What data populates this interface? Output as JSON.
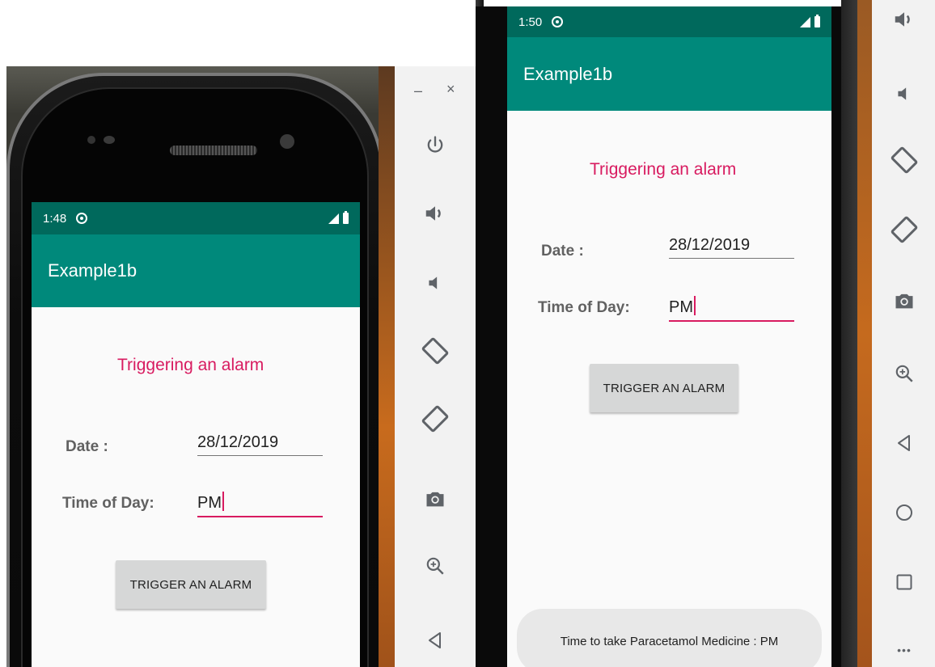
{
  "left_device": {
    "status_time": "1:48",
    "app_title": "Example1b",
    "heading": "Triggering an alarm",
    "date_label": "Date :",
    "date_value": "28/12/2019",
    "time_label": "Time of Day:",
    "time_value": "PM",
    "trigger_button": "TRIGGER AN ALARM"
  },
  "right_device": {
    "status_time": "1:50",
    "app_title": "Example1b",
    "heading": "Triggering an alarm",
    "date_label": "Date :",
    "date_value": "28/12/2019",
    "time_label": "Time of Day:",
    "time_value": "PM",
    "trigger_button": "TRIGGER AN ALARM",
    "toast": "Time to take Paracetamol  Medicine : PM"
  },
  "emulator_toolbar": {
    "minimize": "–",
    "close": "×",
    "more": "•••",
    "icons": [
      "power-icon",
      "volume-up-icon",
      "volume-down-icon",
      "rotate-left-icon",
      "rotate-right-icon",
      "camera-icon",
      "zoom-icon",
      "back-icon",
      "home-icon",
      "overview-icon"
    ]
  },
  "colors": {
    "status_bar": "#00695c",
    "app_bar": "#00897b",
    "accent": "#d81b60",
    "button": "#d6d7d7",
    "toast": "#e8e8e8"
  }
}
